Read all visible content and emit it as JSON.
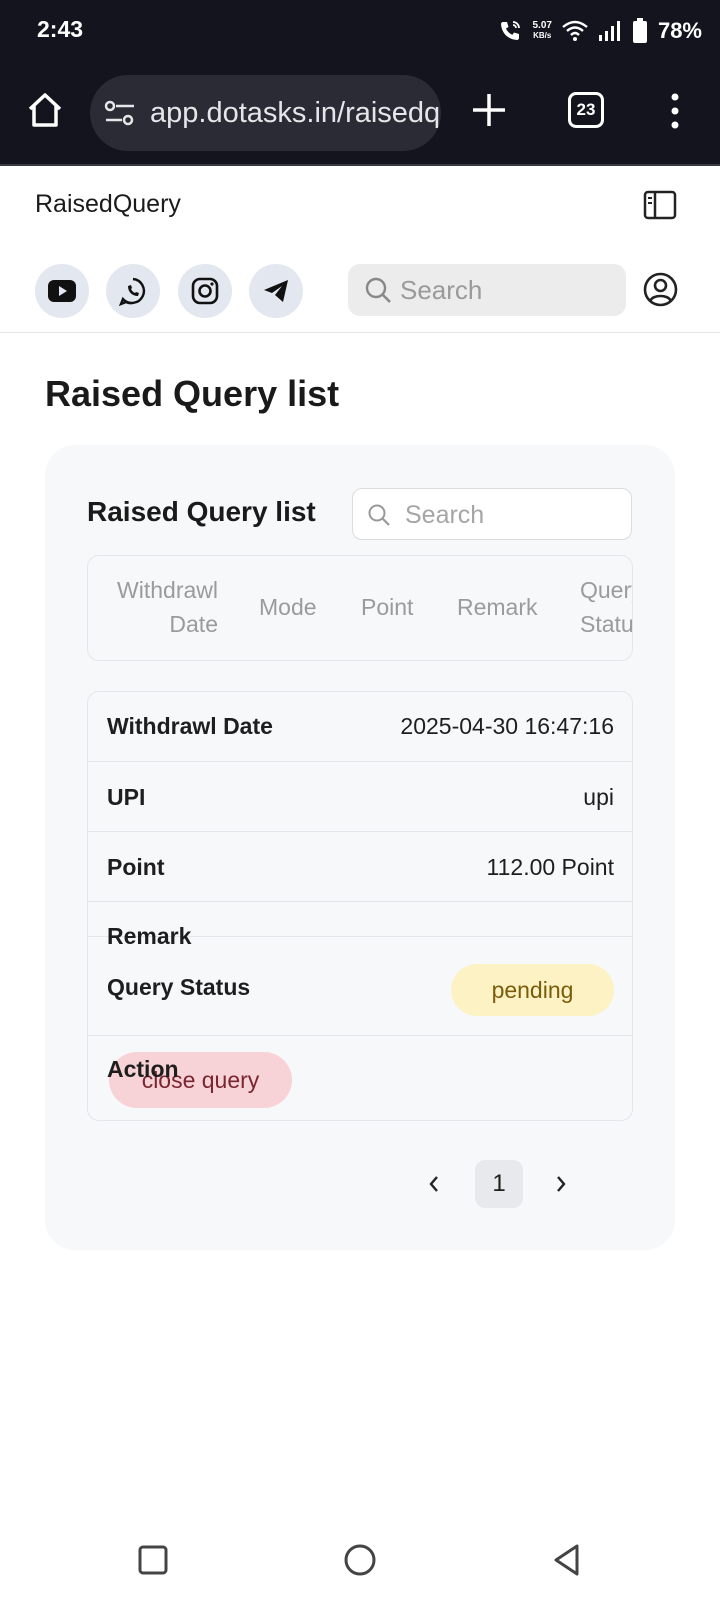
{
  "status_bar": {
    "time": "2:43",
    "net_speed_value": "5.07",
    "net_speed_unit": "KB/s",
    "battery": "78%",
    "icons": [
      "call-icon",
      "wifi-icon",
      "signal-icon",
      "battery-icon"
    ]
  },
  "browser": {
    "url": "app.dotasks.in/raisedquery",
    "tab_count": "23",
    "icons": [
      "home-icon",
      "site-settings-icon",
      "new-tab-icon",
      "tabs-icon",
      "more-menu-icon"
    ]
  },
  "header": {
    "app_title": "RaisedQuery",
    "search_placeholder": "Search",
    "social_icons": [
      "youtube-icon",
      "whatsapp-icon",
      "instagram-icon",
      "telegram-icon"
    ]
  },
  "main": {
    "page_title": "Raised Query list",
    "card": {
      "title": "Raised Query list",
      "search_placeholder": "Search",
      "columns": [
        "Withdrawl Date",
        "Mode",
        "Point",
        "Remark",
        "Query Status"
      ],
      "record": {
        "withdrawl_date_label": "Withdrawl Date",
        "withdrawl_date_value": "2025-04-30 16:47:16",
        "mode_label": "UPI",
        "mode_value": "upi",
        "point_label": "Point",
        "point_value": "112.00 Point",
        "remark_label": "Remark",
        "remark_value": "",
        "status_label": "Query Status",
        "status_value": "pending",
        "action_label": "Action",
        "action_button": "close query"
      },
      "pagination": {
        "current_page": "1"
      }
    }
  },
  "colors": {
    "status_bg": "#14141f",
    "card_bg": "#f7f8fa",
    "pending_bg": "#fdf2c4",
    "close_btn_bg": "#f7d2d6"
  }
}
